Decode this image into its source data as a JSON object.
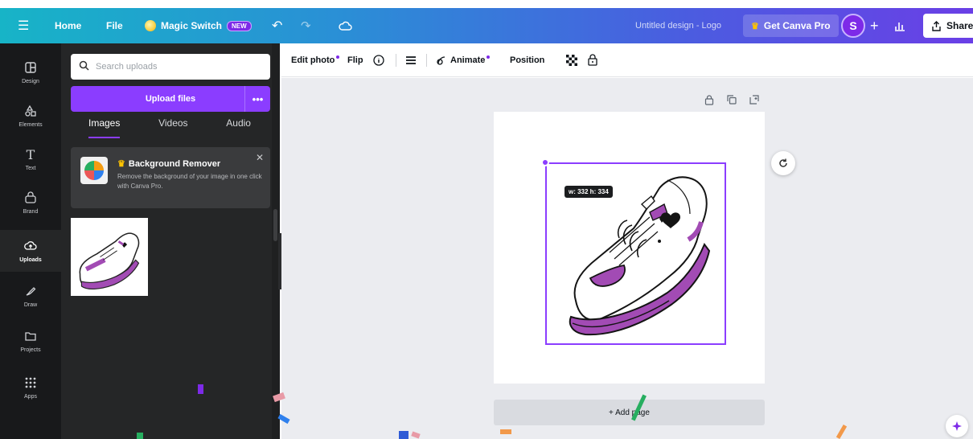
{
  "topbar": {
    "menu_icon": "hamburger-icon",
    "home": "Home",
    "file": "File",
    "magic_switch": "Magic Switch",
    "new_badge": "NEW",
    "doc_title": "Untitled design - Logo",
    "get_pro": "Get Canva Pro",
    "avatar_initial": "S",
    "share": "Share",
    "gradient": [
      "#17b4c7",
      "#6a3fe6"
    ]
  },
  "rail": {
    "items": [
      {
        "label": "Design",
        "icon": "design-icon"
      },
      {
        "label": "Elements",
        "icon": "elements-icon"
      },
      {
        "label": "Text",
        "icon": "text-icon"
      },
      {
        "label": "Brand",
        "icon": "brand-icon"
      },
      {
        "label": "Uploads",
        "icon": "uploads-icon",
        "active": true
      },
      {
        "label": "Draw",
        "icon": "draw-icon"
      },
      {
        "label": "Projects",
        "icon": "folder-icon"
      },
      {
        "label": "Apps",
        "icon": "apps-icon"
      }
    ]
  },
  "panel": {
    "search_placeholder": "Search uploads",
    "upload_label": "Upload files",
    "tabs": [
      "Images",
      "Videos",
      "Audio"
    ],
    "promo": {
      "title": "Background Remover",
      "desc": "Remove the background of your image in one click with Canva Pro."
    }
  },
  "toolbar": {
    "edit_photo": "Edit photo",
    "flip": "Flip",
    "animate": "Animate",
    "position": "Position"
  },
  "canvas": {
    "dims": "w: 332 h: 334",
    "add_page": "+ Add page"
  },
  "colors": {
    "accent": "#8b3dff",
    "shoe_purple": "#a24bb4",
    "panel_bg": "#252627"
  }
}
